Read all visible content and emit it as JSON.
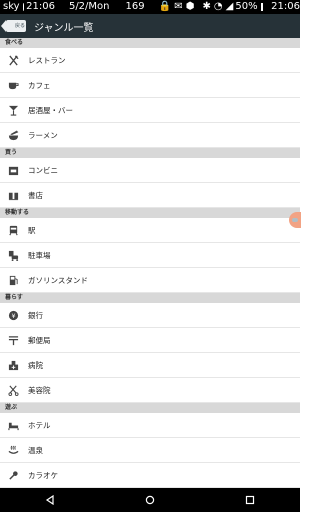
{
  "status_bar": {
    "carrier": "sky",
    "clock_left": "21:06",
    "date": "5/2/Mon",
    "number": "169",
    "battery": "50%",
    "clock_right": "21:06"
  },
  "app_bar": {
    "back_label": "戻る",
    "title": "ジャンル一覧"
  },
  "sections": [
    {
      "header": "食べる",
      "items": [
        {
          "label": "レストラン",
          "icon": "restaurant-icon"
        },
        {
          "label": "カフェ",
          "icon": "cafe-icon"
        },
        {
          "label": "居酒屋・バー",
          "icon": "bar-icon"
        },
        {
          "label": "ラーメン",
          "icon": "ramen-icon"
        }
      ]
    },
    {
      "header": "買う",
      "items": [
        {
          "label": "コンビニ",
          "icon": "convenience-store-icon"
        },
        {
          "label": "書店",
          "icon": "bookstore-icon"
        }
      ]
    },
    {
      "header": "移動する",
      "items": [
        {
          "label": "駅",
          "icon": "train-icon"
        },
        {
          "label": "駐車場",
          "icon": "parking-icon"
        },
        {
          "label": "ガソリンスタンド",
          "icon": "gas-station-icon"
        }
      ]
    },
    {
      "header": "暮らす",
      "items": [
        {
          "label": "銀行",
          "icon": "bank-icon"
        },
        {
          "label": "郵便局",
          "icon": "post-office-icon"
        },
        {
          "label": "病院",
          "icon": "hospital-icon"
        },
        {
          "label": "美容院",
          "icon": "salon-icon"
        }
      ]
    },
    {
      "header": "遊ぶ",
      "items": [
        {
          "label": "ホテル",
          "icon": "hotel-icon"
        },
        {
          "label": "温泉",
          "icon": "hot-spring-icon"
        },
        {
          "label": "カラオケ",
          "icon": "karaoke-icon"
        }
      ]
    }
  ]
}
